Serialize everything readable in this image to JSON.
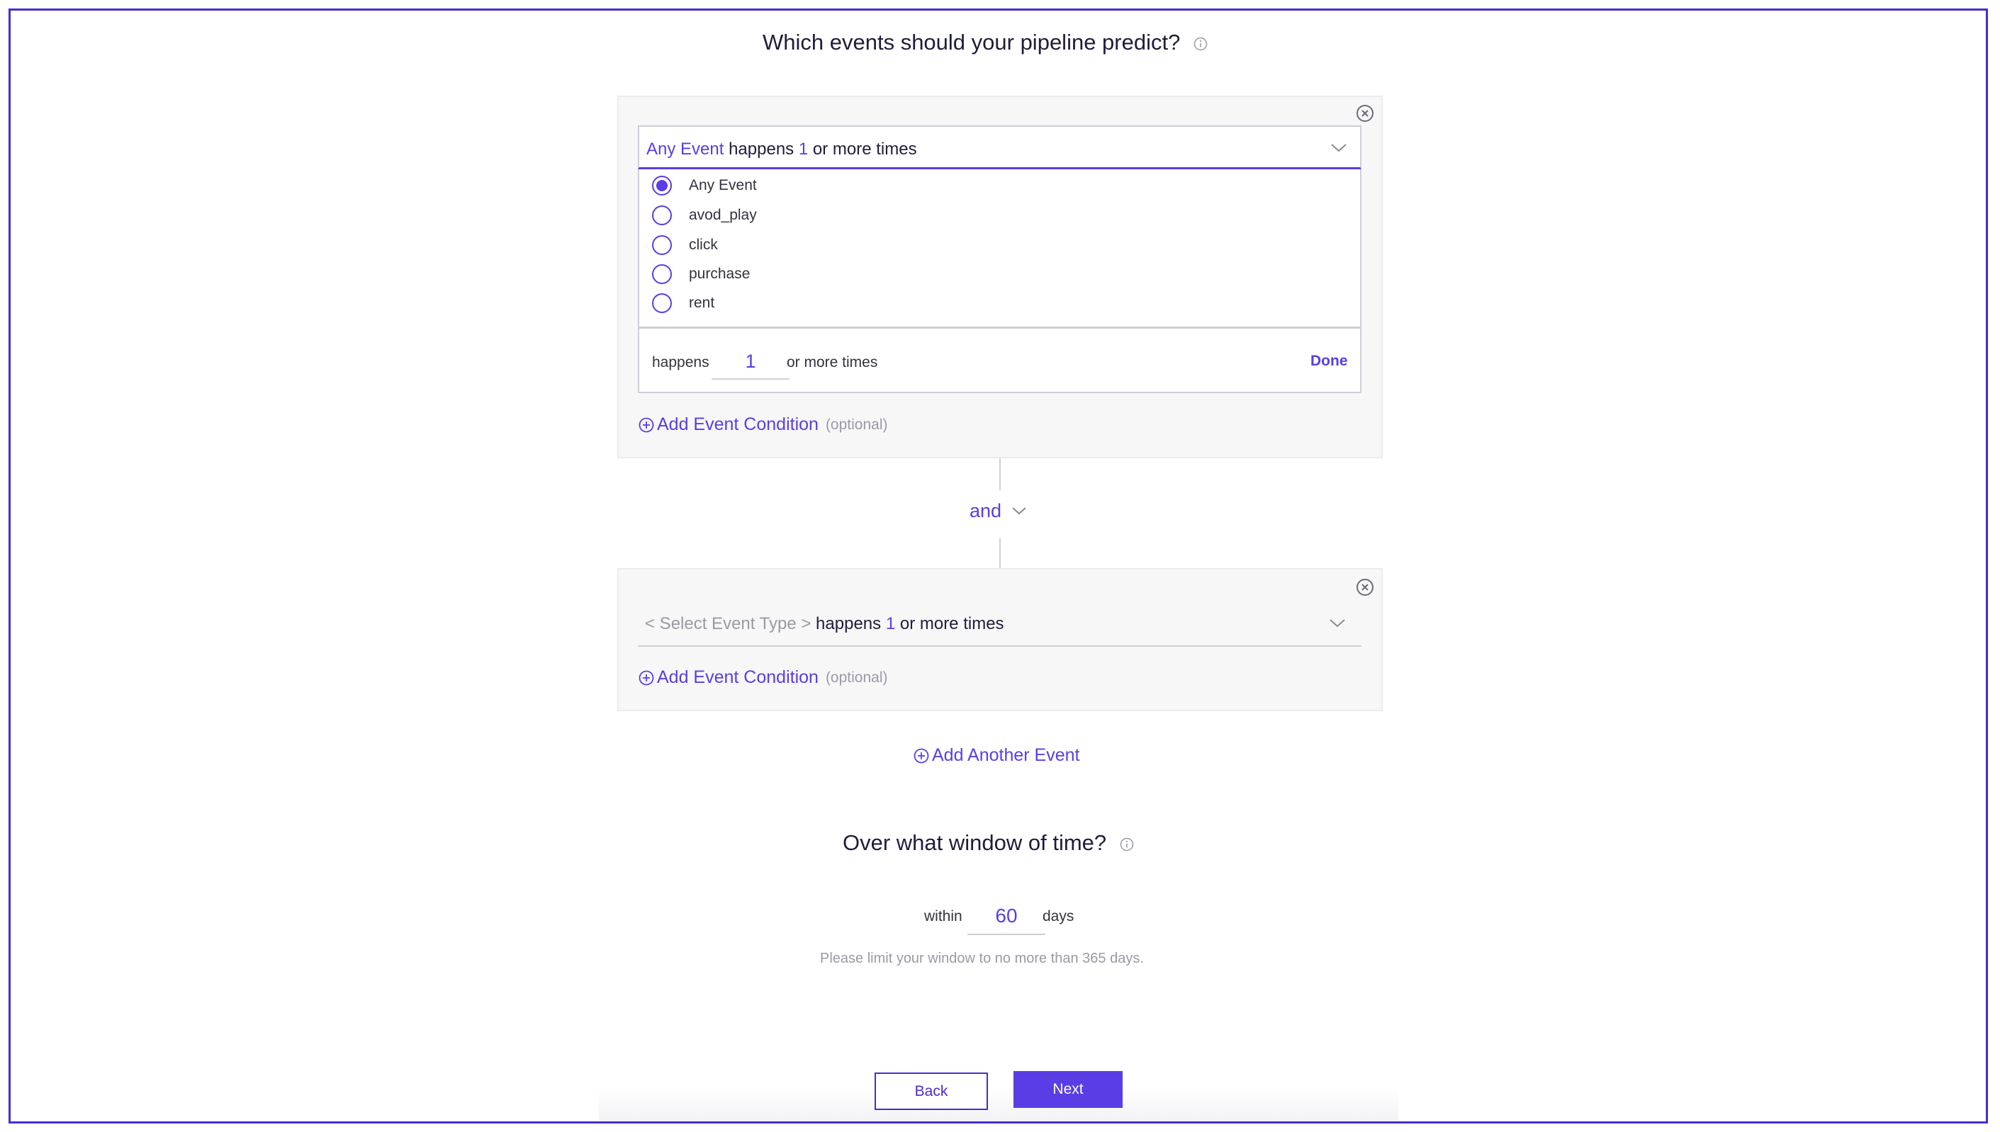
{
  "heading": "Which events should your pipeline predict?",
  "event1": {
    "selected_event": "Any Event",
    "happens_text": "happens",
    "count": "1",
    "suffix_text": "or more times",
    "options": [
      {
        "label": "Any Event",
        "selected": true
      },
      {
        "label": "avod_play",
        "selected": false
      },
      {
        "label": "click",
        "selected": false
      },
      {
        "label": "purchase",
        "selected": false
      },
      {
        "label": "rent",
        "selected": false
      }
    ],
    "footer": {
      "happens_label": "happens",
      "count": "1",
      "suffix_label": "or more times",
      "done_label": "Done"
    },
    "add_condition": "Add Event Condition",
    "optional": "(optional)"
  },
  "connector": {
    "label": "and"
  },
  "event2": {
    "placeholder": "< Select Event Type >",
    "happens_text": "happens",
    "count": "1",
    "suffix_text": "or more times",
    "add_condition": "Add Event Condition",
    "optional": "(optional)"
  },
  "add_another_event": "Add Another Event",
  "window": {
    "heading": "Over what window of time?",
    "within_label": "within",
    "days_value": "60",
    "days_label": "days",
    "hint": "Please limit your window to no more than 365 days."
  },
  "buttons": {
    "back": "Back",
    "next": "Next"
  },
  "colors": {
    "accent": "#5b3de6",
    "frame": "#4b2bd0",
    "card_bg": "#f7f7f8",
    "muted": "#9a9aa6"
  }
}
